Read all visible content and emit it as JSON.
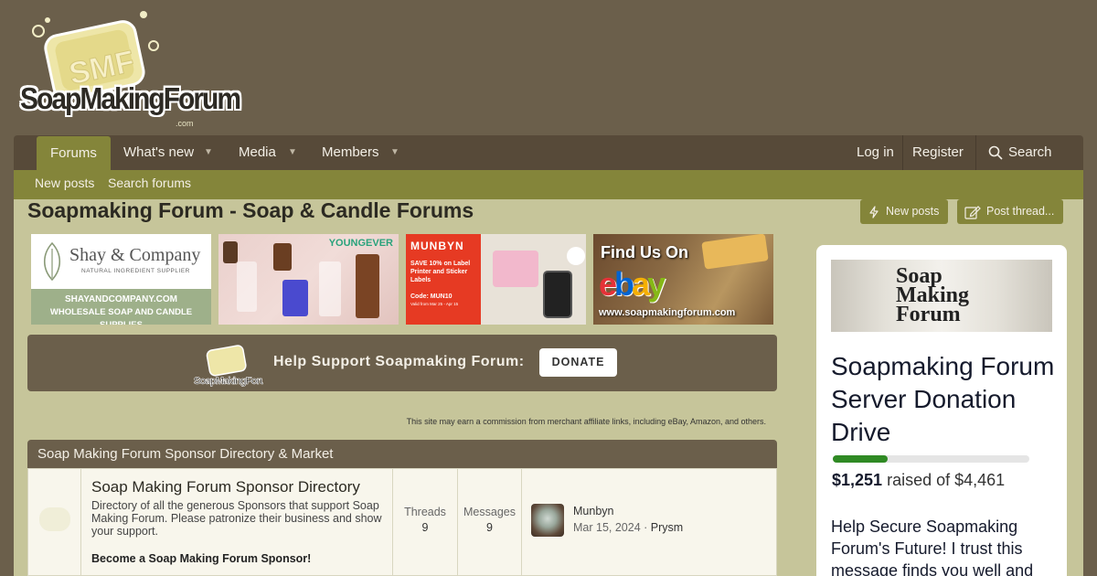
{
  "site": {
    "logo_text": "SoapMakingForum",
    "logo_badge": "SMF",
    "logo_suffix": ".com"
  },
  "nav": {
    "items": [
      {
        "label": "Forums",
        "active": true
      },
      {
        "label": "What's new"
      },
      {
        "label": "Media"
      },
      {
        "label": "Members"
      }
    ],
    "login": "Log in",
    "register": "Register",
    "search": "Search"
  },
  "subnav": {
    "new_posts": "New posts",
    "search_forums": "Search forums"
  },
  "page": {
    "title": "Soapmaking Forum - Soap & Candle Forums",
    "new_posts_btn": "New posts",
    "post_thread_btn": "Post thread..."
  },
  "banners": {
    "shay": {
      "name": "Shay & Company",
      "sub": "NATURAL INGREDIENT SUPPLIER",
      "url": "SHAYANDCOMPANY.COM",
      "tag": "WHOLESALE SOAP AND CANDLE SUPPLIES"
    },
    "bottles": {
      "brand": "YOUNGEVER"
    },
    "munbyn": {
      "brand": "MUNBYN",
      "text": "SAVE 10% on Label Printer and Sticker Labels",
      "code": "Code: MUN10",
      "valid": "Valid from Mar 25 - Apr 15"
    },
    "ebay": {
      "find": "Find Us On",
      "logo": "ebay",
      "url": "www.soapmakingforum.com"
    }
  },
  "donate": {
    "label": "Help Support Soapmaking Forum:",
    "button": "DONATE"
  },
  "affiliate_note": "This site may earn a commission from merchant affiliate links, including eBay, Amazon, and others.",
  "category": {
    "title": "Soap Making Forum Sponsor Directory & Market",
    "node": {
      "title": "Soap Making Forum Sponsor Directory",
      "description": "Directory of all the generous Sponsors that support Soap Making Forum. Please patronize their business and show your support.",
      "cta": "Become a Soap Making Forum Sponsor!",
      "threads_label": "Threads",
      "threads": "9",
      "messages_label": "Messages",
      "messages": "9",
      "last_post_title": "Munbyn",
      "last_post_date": "Mar 15, 2024",
      "last_post_user": "Prysm"
    }
  },
  "sidebar": {
    "image_text": "Soap Making Forum",
    "title": "Soapmaking Forum Server Donation Drive",
    "raised_amount": "$1,251",
    "raised_text": "raised of $4,461",
    "progress_fraction": 0.28,
    "message": "Help Secure Soapmaking Forum's Future! I trust this message finds you well and"
  },
  "colors": {
    "page_bg": "#6b5f4b",
    "accent": "#84853a",
    "content_bg": "#c6c59a",
    "progress": "#2f8a24"
  }
}
